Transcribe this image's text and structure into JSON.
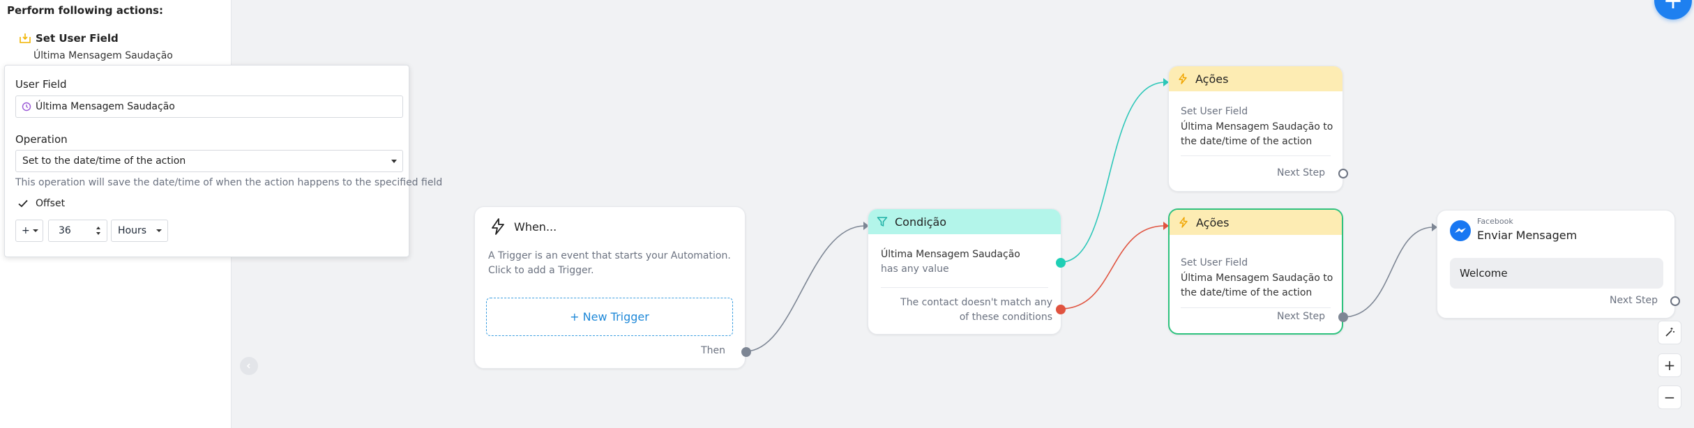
{
  "side_panel": {
    "heading": "Perform following actions:",
    "action": {
      "title": "Set User Field",
      "subtitle": "Última Mensagem Saudação",
      "icon": "import-icon"
    }
  },
  "editor": {
    "user_field_label": "User Field",
    "user_field_value": "Última Mensagem Saudação",
    "operation_label": "Operation",
    "operation_value": "Set to the date/time of the action",
    "operation_hint": "This operation will save the date/time of when the action happens to the specified field",
    "offset_label": "Offset",
    "offset_checked": true,
    "offset_sign": "+",
    "offset_amount": "36",
    "offset_unit": "Hours"
  },
  "nodes": {
    "trigger": {
      "title": "When...",
      "description_line1": "A Trigger is an event that starts your Automation.",
      "description_line2": "Click to add a Trigger.",
      "new_trigger": "+ New Trigger",
      "then": "Then"
    },
    "condition": {
      "title": "Condição",
      "field": "Última Mensagem Saudação",
      "operator": "has any value",
      "else_line1": "The contact doesn't match any",
      "else_line2": "of these conditions"
    },
    "actions_top": {
      "title": "Ações",
      "action_type": "Set User Field",
      "line1": "Última Mensagem Saudação to",
      "line2": "the date/time of the action",
      "next": "Next Step"
    },
    "actions_bottom": {
      "title": "Ações",
      "action_type": "Set User Field",
      "line1": "Última Mensagem Saudação to",
      "line2": "the date/time of the action",
      "next": "Next Step"
    },
    "facebook": {
      "channel": "Facebook",
      "title": "Enviar Mensagem",
      "message": "Welcome",
      "next": "Next Step"
    }
  },
  "controls": {
    "fab": "+",
    "zoom_in": "+",
    "zoom_out": "−"
  },
  "colors": {
    "accent_blue": "#1e80f0",
    "condition_header": "#b3f5ea",
    "actions_header": "#fdecb3",
    "success_green": "#2ec27e",
    "wire_teal": "#2cc7b8",
    "wire_red": "#e0533f",
    "wire_gray": "#7d8694"
  }
}
